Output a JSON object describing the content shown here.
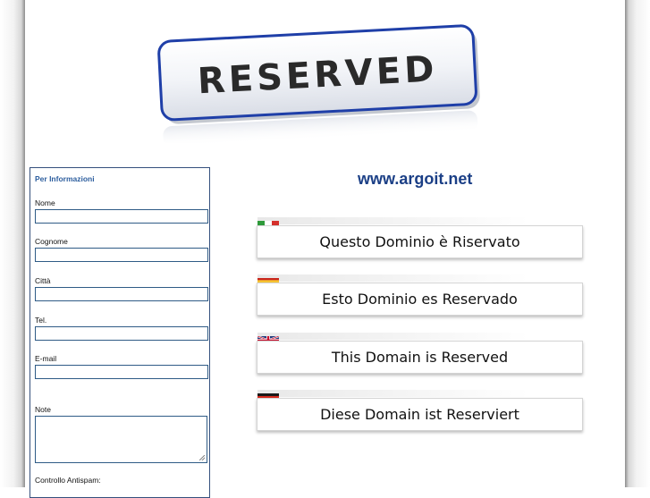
{
  "logo": {
    "text": "RESERVED"
  },
  "site": {
    "domain": "www.argoit.net"
  },
  "form": {
    "title": "Per Informazioni",
    "fields": {
      "nome": {
        "label": "Nome",
        "value": ""
      },
      "cognome": {
        "label": "Cognome",
        "value": ""
      },
      "citta": {
        "label": "Città",
        "value": ""
      },
      "tel": {
        "label": "Tel.",
        "value": ""
      },
      "email": {
        "label": "E-mail",
        "value": ""
      },
      "note": {
        "label": "Note",
        "value": ""
      }
    },
    "antispam_label": "Controllo Antispam:"
  },
  "languages": [
    {
      "flag": "italy-flag-icon",
      "text": "Questo Dominio è Riservato"
    },
    {
      "flag": "spain-flag-icon",
      "text": "Esto Dominio es Reservado"
    },
    {
      "flag": "uk-flag-icon",
      "text": "This Domain is Reserved"
    },
    {
      "flag": "germany-flag-icon",
      "text": "Diese Domain ist Reserviert"
    }
  ],
  "colors": {
    "domain_heading": "#1b3f86",
    "form_border": "#35507d",
    "form_title": "#2d5e9e",
    "logo_border": "#1f3fa8",
    "logo_text": "#2a2a2a"
  }
}
